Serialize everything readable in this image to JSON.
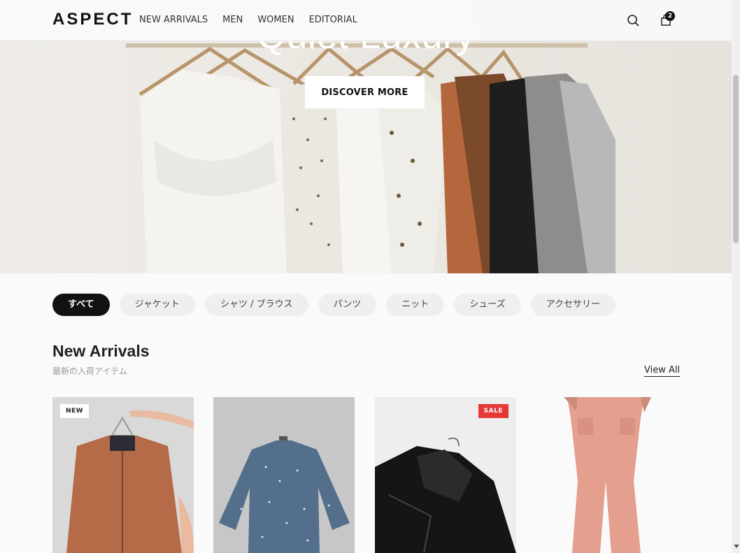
{
  "brand": {
    "logo": "ASPECT"
  },
  "nav": {
    "items": [
      "NEW ARRIVALS",
      "MEN",
      "WOMEN",
      "EDITORIAL"
    ]
  },
  "header": {
    "cart_count": "2",
    "icons": [
      "search-icon",
      "shopping-bag-icon"
    ]
  },
  "hero": {
    "title": "Quiet Luxury",
    "cta_label": "DISCOVER MORE"
  },
  "categories": {
    "items": [
      "すべて",
      "ジャケット",
      "シャツ / ブラウス",
      "パンツ",
      "ニット",
      "シューズ",
      "アクセサリー"
    ],
    "active": "すべて"
  },
  "section": {
    "title": "New Arrivals",
    "subtitle": "最新の入荷アイテム",
    "view_all": "View All"
  },
  "products": [
    {
      "badge": "NEW"
    },
    {
      "badge": ""
    },
    {
      "badge": "SALE"
    },
    {
      "badge": ""
    }
  ],
  "colors": {
    "accent": "#111111",
    "sale": "#e53935",
    "chip_bg": "#efefef"
  }
}
